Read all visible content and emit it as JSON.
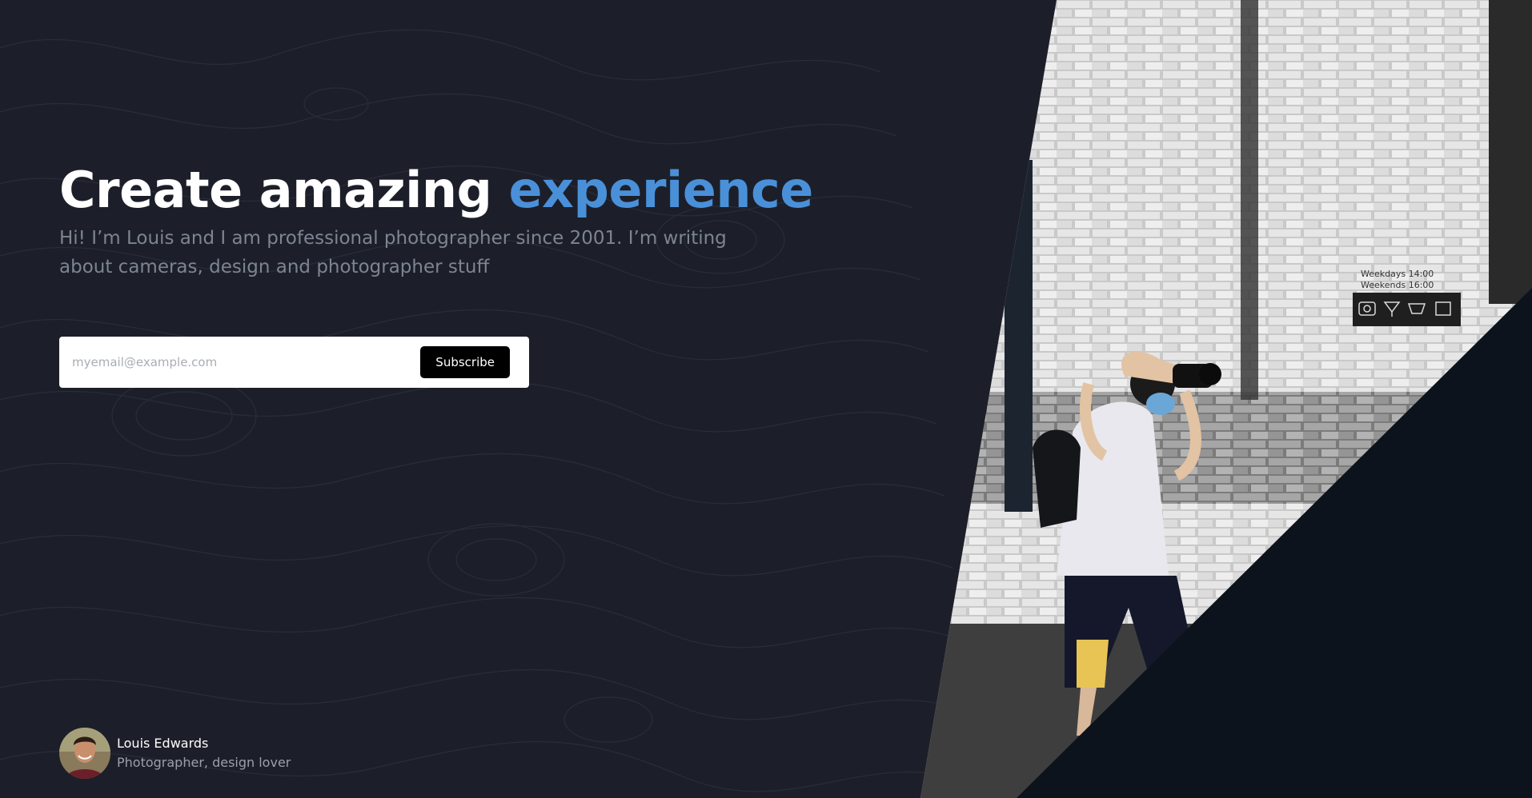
{
  "hero": {
    "headline_main": "Create amazing ",
    "headline_accent": "experience",
    "subtitle": "Hi! I’m Louis and I am professional photographer since 2001. I’m writing about cameras, design and photographer stuff"
  },
  "subscribe": {
    "placeholder": "myemail@example.com",
    "button_label": "Subscribe"
  },
  "author": {
    "name": "Louis Edwards",
    "role": "Photographer, design lover"
  },
  "photo": {
    "sign_line_1": "Weekdays 14:00",
    "sign_line_2": "Weekends 16:00"
  },
  "colors": {
    "background": "#1c1f29",
    "accent": "#4a90d9",
    "button": "#000000"
  }
}
